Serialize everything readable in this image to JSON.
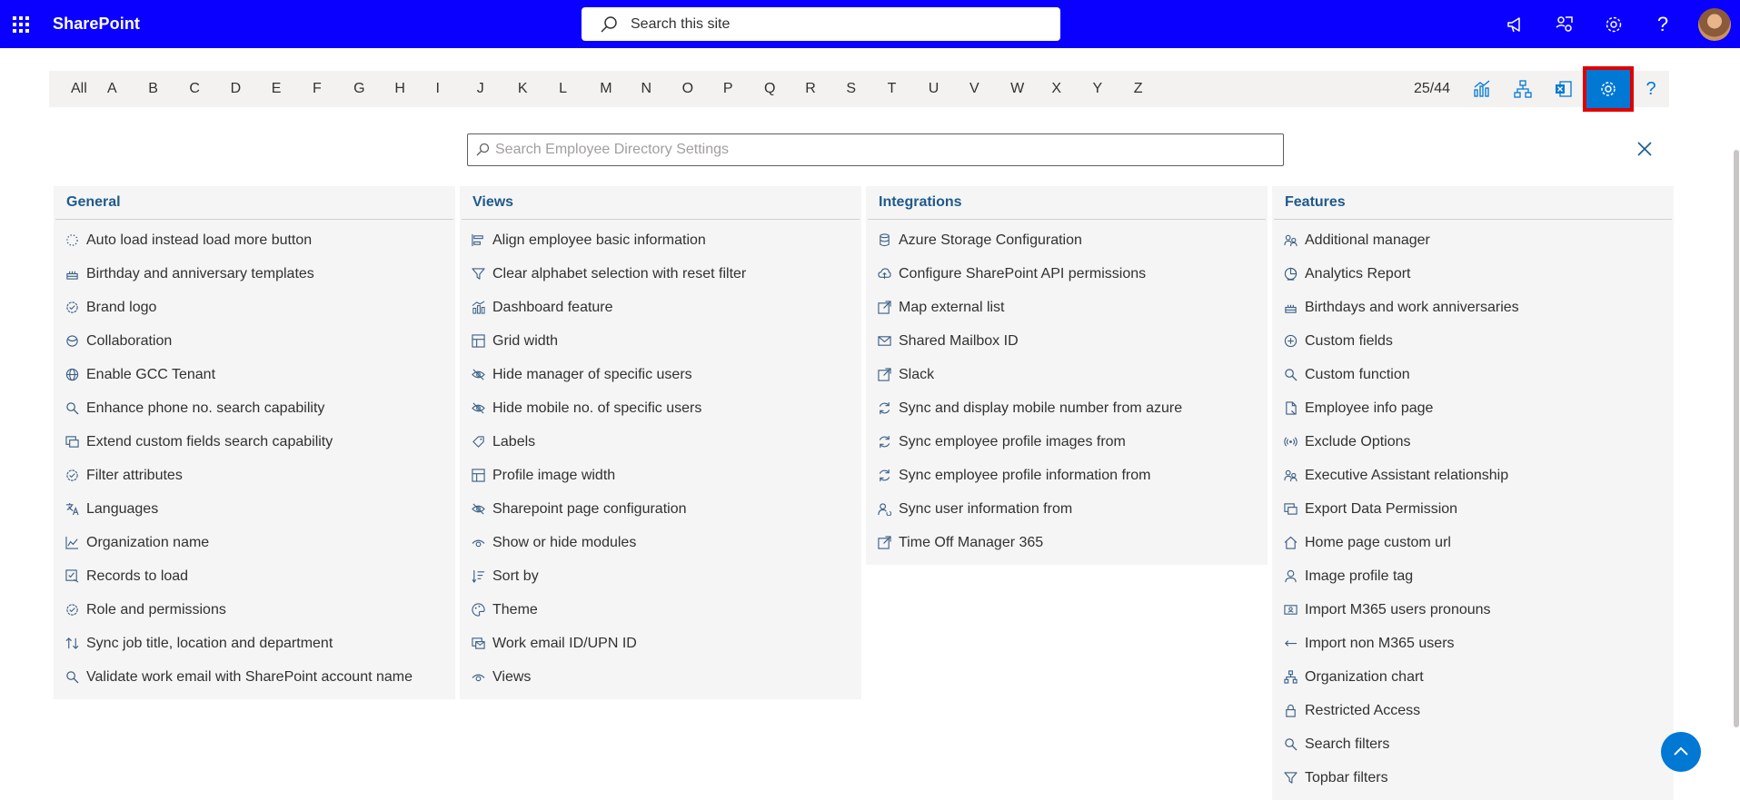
{
  "topbar": {
    "brand": "SharePoint",
    "search_placeholder": "Search this site"
  },
  "alphabet": {
    "letters": [
      "All",
      "A",
      "B",
      "C",
      "D",
      "E",
      "F",
      "G",
      "H",
      "I",
      "J",
      "K",
      "L",
      "M",
      "N",
      "O",
      "P",
      "Q",
      "R",
      "S",
      "T",
      "U",
      "V",
      "W",
      "X",
      "Y",
      "Z"
    ],
    "count": "25/44",
    "help": "?"
  },
  "settings": {
    "search_placeholder": "Search Employee Directory Settings"
  },
  "columns": [
    {
      "title": "General",
      "items": [
        {
          "label": "Auto load instead load more button",
          "icon": "loading-icon"
        },
        {
          "label": "Birthday and anniversary templates",
          "icon": "cake-icon"
        },
        {
          "label": "Brand logo",
          "icon": "badge-check-icon"
        },
        {
          "label": "Collaboration",
          "icon": "collaboration-icon"
        },
        {
          "label": "Enable GCC Tenant",
          "icon": "globe-icon"
        },
        {
          "label": "Enhance phone no. search capability",
          "icon": "search-icon"
        },
        {
          "label": "Extend custom fields search capability",
          "icon": "extend-icon"
        },
        {
          "label": "Filter attributes",
          "icon": "badge-check-icon"
        },
        {
          "label": "Languages",
          "icon": "translate-icon"
        },
        {
          "label": "Organization name",
          "icon": "chart-icon"
        },
        {
          "label": "Records to load",
          "icon": "checklist-icon"
        },
        {
          "label": "Role and permissions",
          "icon": "badge-check-icon"
        },
        {
          "label": "Sync job title, location and department",
          "icon": "sort-arrows-icon"
        },
        {
          "label": "Validate work email with SharePoint account name",
          "icon": "search-icon"
        }
      ]
    },
    {
      "title": "Views",
      "items": [
        {
          "label": "Align employee basic information",
          "icon": "align-icon"
        },
        {
          "label": "Clear alphabet selection with reset filter",
          "icon": "filter-icon"
        },
        {
          "label": "Dashboard feature",
          "icon": "dashboard-icon"
        },
        {
          "label": "Grid width",
          "icon": "grid-icon"
        },
        {
          "label": "Hide manager of specific users",
          "icon": "eye-off-icon"
        },
        {
          "label": "Hide mobile no. of specific users",
          "icon": "eye-off-icon"
        },
        {
          "label": "Labels",
          "icon": "tag-icon"
        },
        {
          "label": "Profile image width",
          "icon": "grid-icon"
        },
        {
          "label": "Sharepoint page configuration",
          "icon": "eye-off-icon"
        },
        {
          "label": "Show or hide modules",
          "icon": "eye-icon"
        },
        {
          "label": "Sort by",
          "icon": "sort-icon"
        },
        {
          "label": "Theme",
          "icon": "palette-icon"
        },
        {
          "label": "Work email ID/UPN ID",
          "icon": "email-icon"
        },
        {
          "label": "Views",
          "icon": "eye-icon"
        }
      ]
    },
    {
      "title": "Integrations",
      "items": [
        {
          "label": "Azure Storage Configuration",
          "icon": "database-icon"
        },
        {
          "label": "Configure SharePoint API permissions",
          "icon": "cloud-icon"
        },
        {
          "label": "Map external list",
          "icon": "external-icon"
        },
        {
          "label": "Shared Mailbox ID",
          "icon": "mail-icon"
        },
        {
          "label": "Slack",
          "icon": "external-icon"
        },
        {
          "label": "Sync and display mobile number from azure",
          "icon": "sync-icon"
        },
        {
          "label": "Sync employee profile images from",
          "icon": "sync-icon"
        },
        {
          "label": "Sync employee profile information from",
          "icon": "sync-icon"
        },
        {
          "label": "Sync user information from",
          "icon": "user-sync-icon"
        },
        {
          "label": "Time Off Manager 365",
          "icon": "external-icon"
        }
      ]
    },
    {
      "title": "Features",
      "items": [
        {
          "label": "Additional manager",
          "icon": "people-icon"
        },
        {
          "label": "Analytics Report",
          "icon": "analytics-icon"
        },
        {
          "label": "Birthdays and work anniversaries",
          "icon": "cake-icon"
        },
        {
          "label": "Custom fields",
          "icon": "add-circle-icon"
        },
        {
          "label": "Custom function",
          "icon": "search-icon"
        },
        {
          "label": "Employee info page",
          "icon": "document-icon"
        },
        {
          "label": "Exclude Options",
          "icon": "broadcast-icon"
        },
        {
          "label": "Executive Assistant relationship",
          "icon": "people-icon"
        },
        {
          "label": "Export Data Permission",
          "icon": "extend-icon"
        },
        {
          "label": "Home page custom url",
          "icon": "home-icon"
        },
        {
          "label": "Image profile tag",
          "icon": "person-icon"
        },
        {
          "label": "Import M365 users pronouns",
          "icon": "id-card-icon"
        },
        {
          "label": "Import non M365 users",
          "icon": "import-arrow-icon"
        },
        {
          "label": "Organization chart",
          "icon": "org-chart-icon"
        },
        {
          "label": "Restricted Access",
          "icon": "lock-icon"
        },
        {
          "label": "Search filters",
          "icon": "search-icon"
        },
        {
          "label": "Topbar filters",
          "icon": "filter-icon"
        }
      ]
    }
  ],
  "colors": {
    "topbar": "#0a00ff",
    "accent": "#0078d4",
    "heading": "#1e5a8c",
    "highlight_border": "#e00000"
  }
}
